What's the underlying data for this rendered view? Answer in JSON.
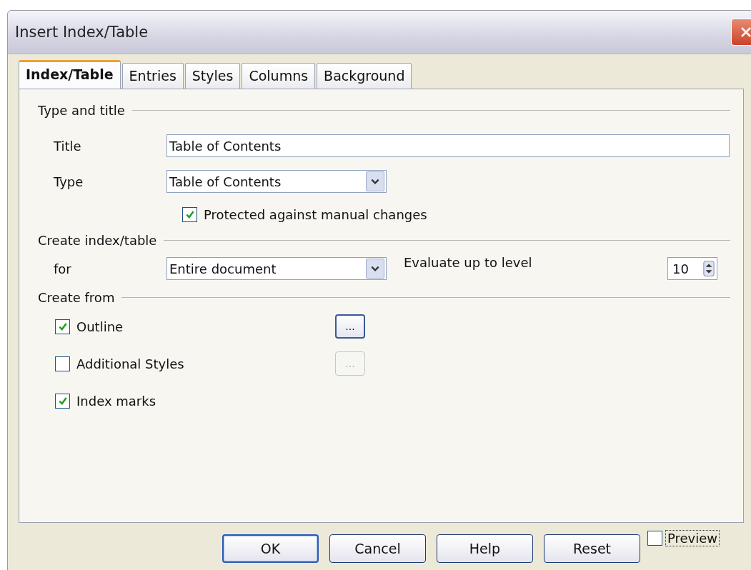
{
  "window": {
    "title": "Insert Index/Table"
  },
  "tabs": [
    {
      "label": "Index/Table",
      "selected": true
    },
    {
      "label": "Entries",
      "selected": false
    },
    {
      "label": "Styles",
      "selected": false
    },
    {
      "label": "Columns",
      "selected": false
    },
    {
      "label": "Background",
      "selected": false
    }
  ],
  "type_and_title": {
    "heading": "Type and title",
    "title_label": "Title",
    "title_value": "Table of Contents",
    "type_label": "Type",
    "type_value": "Table of Contents",
    "protected": {
      "label": "Protected against manual changes",
      "checked": true
    }
  },
  "create_index": {
    "heading": "Create index/table",
    "for_label": "for",
    "for_value": "Entire document",
    "evaluate_label": "Evaluate up to level",
    "level_value": "10"
  },
  "create_from": {
    "heading": "Create from",
    "options": [
      {
        "label": "Outline",
        "checked": true,
        "more_button": {
          "label": "...",
          "disabled": false
        }
      },
      {
        "label": "Additional Styles",
        "checked": false,
        "more_button": {
          "label": "...",
          "disabled": true
        }
      },
      {
        "label": "Index marks",
        "checked": true
      }
    ]
  },
  "buttons": [
    {
      "label": "OK",
      "default": true
    },
    {
      "label": "Cancel",
      "default": false
    },
    {
      "label": "Help",
      "default": false
    },
    {
      "label": "Reset",
      "default": false
    }
  ],
  "preview": {
    "label": "Preview",
    "checked": false
  }
}
